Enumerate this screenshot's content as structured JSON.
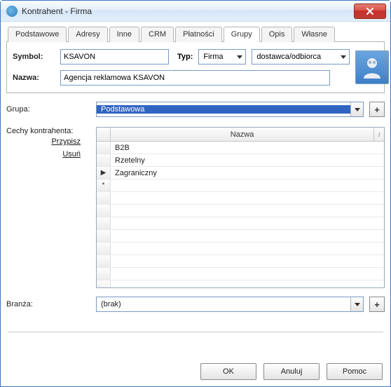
{
  "window": {
    "title": "Kontrahent - Firma"
  },
  "tabs": [
    {
      "label": "Podstawowe"
    },
    {
      "label": "Adresy"
    },
    {
      "label": "Inne"
    },
    {
      "label": "CRM"
    },
    {
      "label": "Płatności"
    },
    {
      "label": "Grupy",
      "active": true
    },
    {
      "label": "Opis"
    },
    {
      "label": "Własne"
    }
  ],
  "header": {
    "symbol_label": "Symbol:",
    "symbol_value": "KSAVON",
    "typ_label": "Typ:",
    "typ_value": "Firma",
    "rola_value": "dostawca/odbiorca",
    "nazwa_label": "Nazwa:",
    "nazwa_value": "Agencja reklamowa KSAVON"
  },
  "grupa": {
    "label": "Grupa:",
    "value": "Podstawowa",
    "add": "+"
  },
  "cechy": {
    "label": "Cechy kontrahenta:",
    "link_przypisz": "Przypisz",
    "link_usun": "Usuń",
    "col_nazwa": "Nazwa",
    "rows": [
      {
        "marker": "",
        "value": "B2B"
      },
      {
        "marker": "",
        "value": "Rzetelny"
      },
      {
        "marker": "▶",
        "value": "Zagraniczny"
      },
      {
        "marker": "*",
        "value": ""
      }
    ]
  },
  "branza": {
    "label": "Branża:",
    "value": "(brak)",
    "add": "+"
  },
  "buttons": {
    "ok": "OK",
    "anuluj": "Anuluj",
    "pomoc": "Pomoc"
  }
}
